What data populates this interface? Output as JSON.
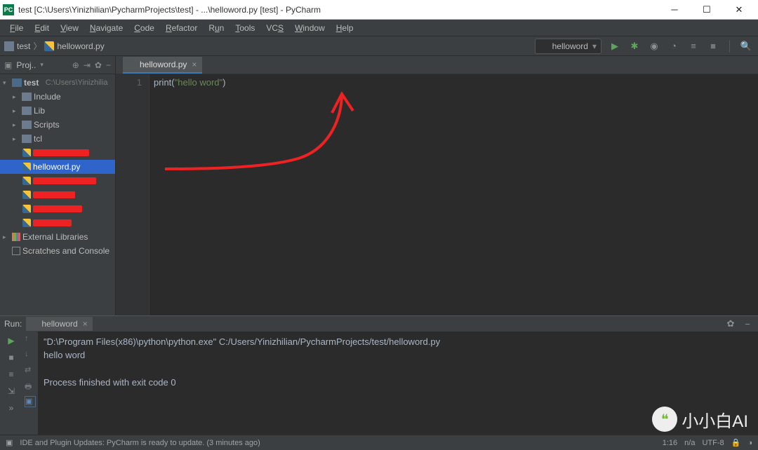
{
  "titlebar": {
    "title": "test [C:\\Users\\Yinizhilian\\PycharmProjects\\test] - ...\\helloword.py [test] - PyCharm"
  },
  "menu": [
    "File",
    "Edit",
    "View",
    "Navigate",
    "Code",
    "Refactor",
    "Run",
    "Tools",
    "VCS",
    "Window",
    "Help"
  ],
  "breadcrumb": {
    "item1": "test",
    "item2": "helloword.py"
  },
  "runconfig": {
    "label": "helloword"
  },
  "proj": {
    "head": "Proj..",
    "root": "test",
    "rootpath": "C:\\Users\\Yinizhilia",
    "folders": [
      "Include",
      "Lib",
      "Scripts",
      "tcl"
    ],
    "selected": "helloword.py",
    "ext": "External Libraries",
    "scratch": "Scratches and Console"
  },
  "editor": {
    "tab": "helloword.py",
    "lineno": "1",
    "code_fn": "print",
    "code_open": "(",
    "code_str": "\"hello word\"",
    "code_close": ")"
  },
  "run": {
    "head": "Run:",
    "tab": "helloword",
    "line1": "\"D:\\Program Files(x86)\\python\\python.exe\" C:/Users/Yinizhilian/PycharmProjects/test/helloword.py",
    "line2": "hello word",
    "line3": "",
    "line4": "Process finished with exit code 0"
  },
  "status": {
    "msg": "IDE and Plugin Updates: PyCharm is ready to update. (3 minutes ago)",
    "pos": "1:16",
    "na": "n/a",
    "enc": "UTF-8",
    "lock": "🔒"
  },
  "watermark": "小小白AI"
}
